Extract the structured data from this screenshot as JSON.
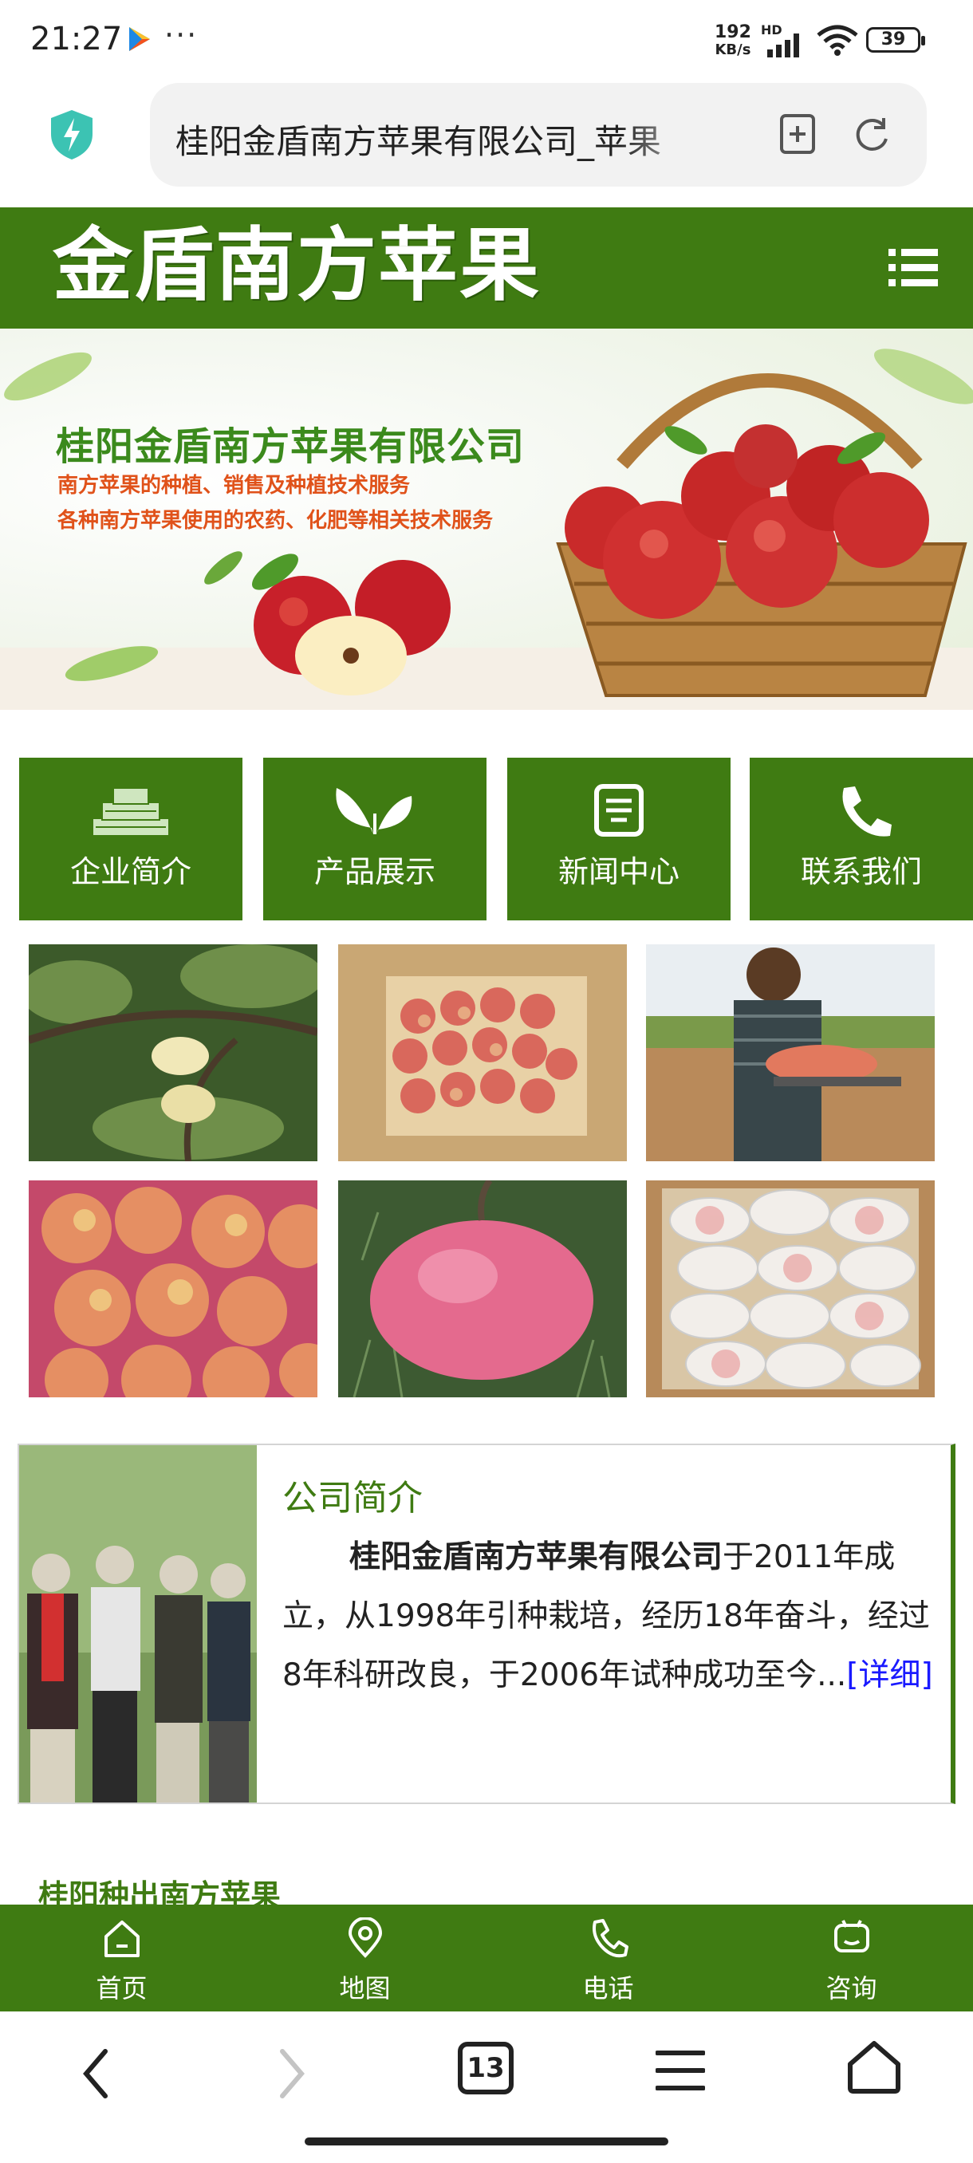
{
  "status_bar": {
    "time": "21:27",
    "dots": "···",
    "net_speed_value": "192",
    "net_speed_unit": "KB/s",
    "hd": "HD",
    "battery": "39",
    "icons": [
      "play-store-icon",
      "signal-icon",
      "wifi-icon",
      "battery-icon"
    ]
  },
  "browser": {
    "url_text": "桂阳金盾南方苹果有限公司_苹果",
    "icons": [
      "shield-icon",
      "add-bookmark-icon",
      "reload-icon"
    ]
  },
  "site": {
    "logo": "金盾南方苹果",
    "banner": {
      "title": "桂阳金盾南方苹果有限公司",
      "line1": "南方苹果的种植、销售及种植技术服务",
      "line2": "各种南方苹果使用的农药、化肥等相关技术服务"
    },
    "nav_tiles": [
      {
        "label": "企业简介",
        "icon": "building-icon"
      },
      {
        "label": "产品展示",
        "icon": "leaf-icon"
      },
      {
        "label": "新闻中心",
        "icon": "news-icon"
      },
      {
        "label": "联系我们",
        "icon": "phone-icon"
      }
    ],
    "intro": {
      "title": "公司简介",
      "company": "桂阳金盾南方苹果有限公司",
      "body": "于2011年成立，从1998年引种栽培，经历18年奋斗，经过8年科研改良，于2006年试种成功至今...",
      "more": "[详细]"
    },
    "section_peek": "桂阳种出南方苹果",
    "bottom_nav": [
      {
        "label": "首页",
        "icon": "home-icon"
      },
      {
        "label": "地图",
        "icon": "map-pin-icon"
      },
      {
        "label": "电话",
        "icon": "phone-icon"
      },
      {
        "label": "咨询",
        "icon": "chat-icon"
      }
    ]
  },
  "browser_toolbar": {
    "tab_count": "13",
    "icons": [
      "back-icon",
      "forward-icon",
      "tabs-icon",
      "menu-icon",
      "home-icon"
    ]
  },
  "colors": {
    "brand_green": "#3f7b12",
    "link_blue": "#1a1aff"
  }
}
